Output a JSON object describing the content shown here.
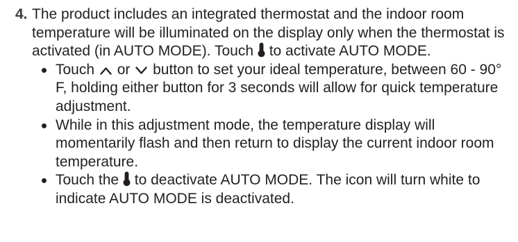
{
  "step": {
    "number": "4.",
    "text_before_icon": "The product includes an integrated thermostat and the indoor room temperature will be illuminated on the display only when the thermostat is activated (in AUTO MODE). Touch",
    "text_after_icon": "to activate AUTO MODE.",
    "icon": "thermometer-icon"
  },
  "bullets": [
    {
      "text_start": "Touch",
      "icon_up": "chevron-up-icon",
      "text_or": "or",
      "icon_down": "chevron-down-icon",
      "text_end": "button to set your ideal temperature, between 60 - 90° F, holding either button for 3 seconds will allow for quick temperature adjustment."
    },
    {
      "text": "While in this adjustment mode, the temperature display will momentarily flash and then return to display the current indoor room temperature."
    },
    {
      "text_start": "Touch the",
      "icon": "thermometer-icon",
      "text_end": "to deactivate AUTO MODE. The icon will turn white to indicate AUTO MODE is deactivated."
    }
  ]
}
